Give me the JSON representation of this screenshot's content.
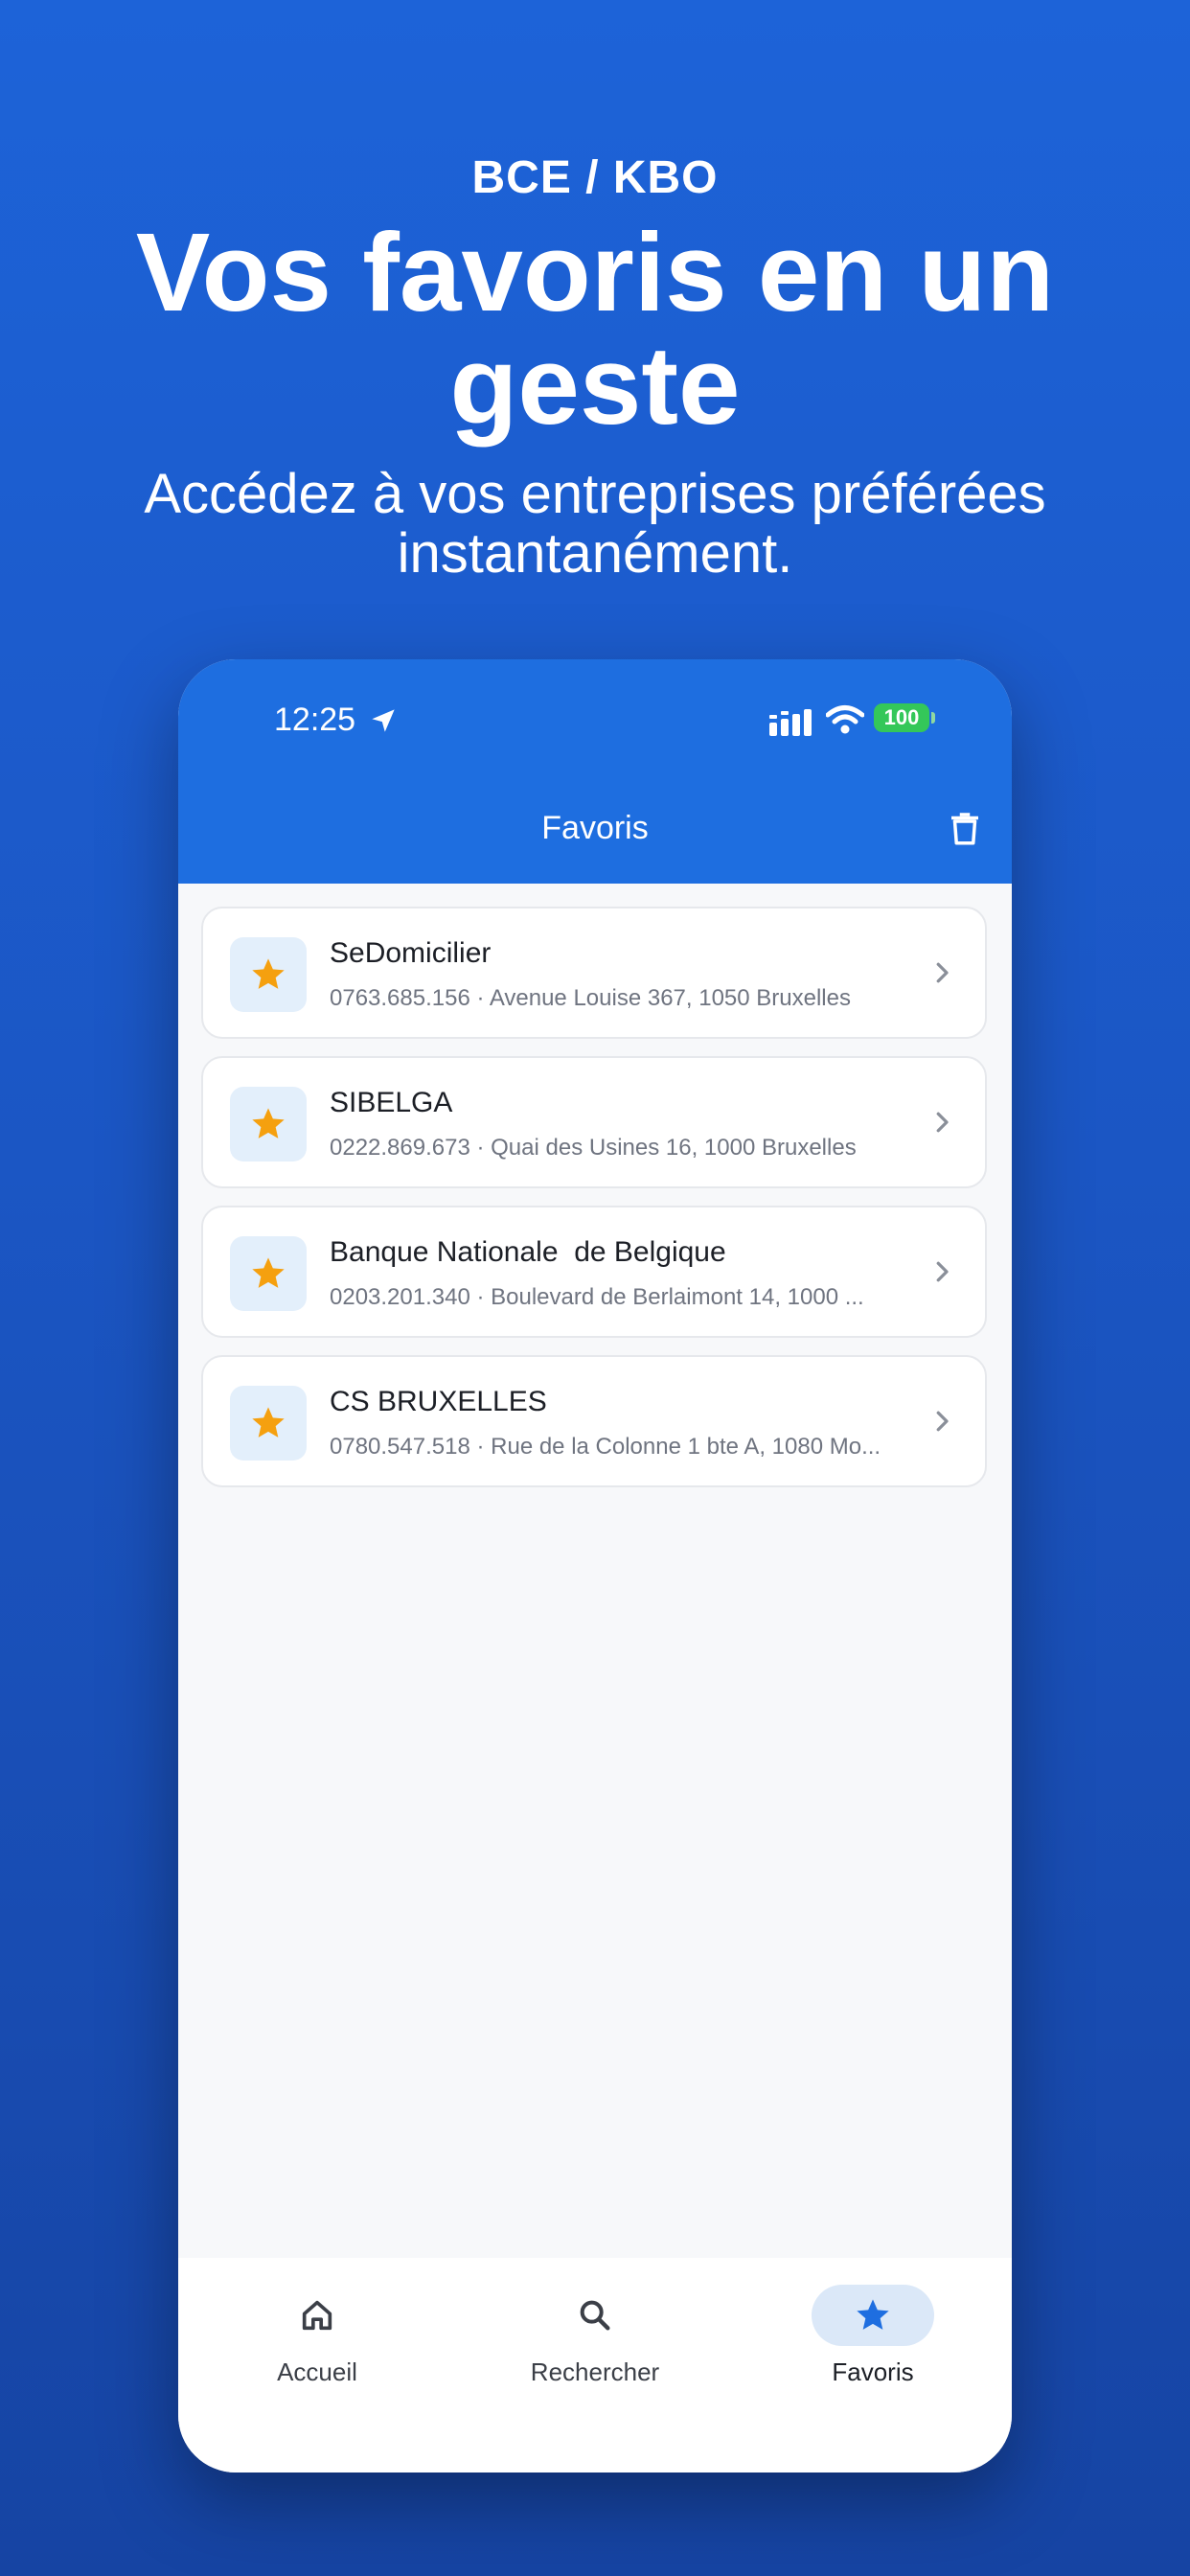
{
  "hero": {
    "kicker": "BCE / KBO",
    "title": "Vos favoris en un geste",
    "subtitle": "Accédez à vos entreprises préférées instantanément."
  },
  "status_bar": {
    "time": "12:25",
    "battery": "100"
  },
  "app_bar": {
    "title": "Favoris",
    "action_icon": "trash-icon"
  },
  "favorites": [
    {
      "name": "SeDomicilier",
      "details": "0763.685.156 · Avenue Louise 367, 1050 Bruxelles"
    },
    {
      "name": "SIBELGA",
      "details": "0222.869.673 · Quai des Usines 16, 1000 Bruxelles"
    },
    {
      "name": "Banque Nationale  de Belgique",
      "details": "0203.201.340 · Boulevard de Berlaimont 14, 1000 ..."
    },
    {
      "name": "CS BRUXELLES",
      "details": "0780.547.518 · Rue de la Colonne 1 bte A, 1080 Mo..."
    }
  ],
  "bottom_nav": [
    {
      "label": "Accueil",
      "icon": "home-icon",
      "active": false
    },
    {
      "label": "Rechercher",
      "icon": "search-icon",
      "active": false
    },
    {
      "label": "Favoris",
      "icon": "star-icon",
      "active": true
    }
  ],
  "colors": {
    "brand_blue": "#1e6ee0",
    "star_orange": "#f5a00f",
    "battery_green": "#34c759",
    "active_tab_bg": "#dbe8f8"
  }
}
